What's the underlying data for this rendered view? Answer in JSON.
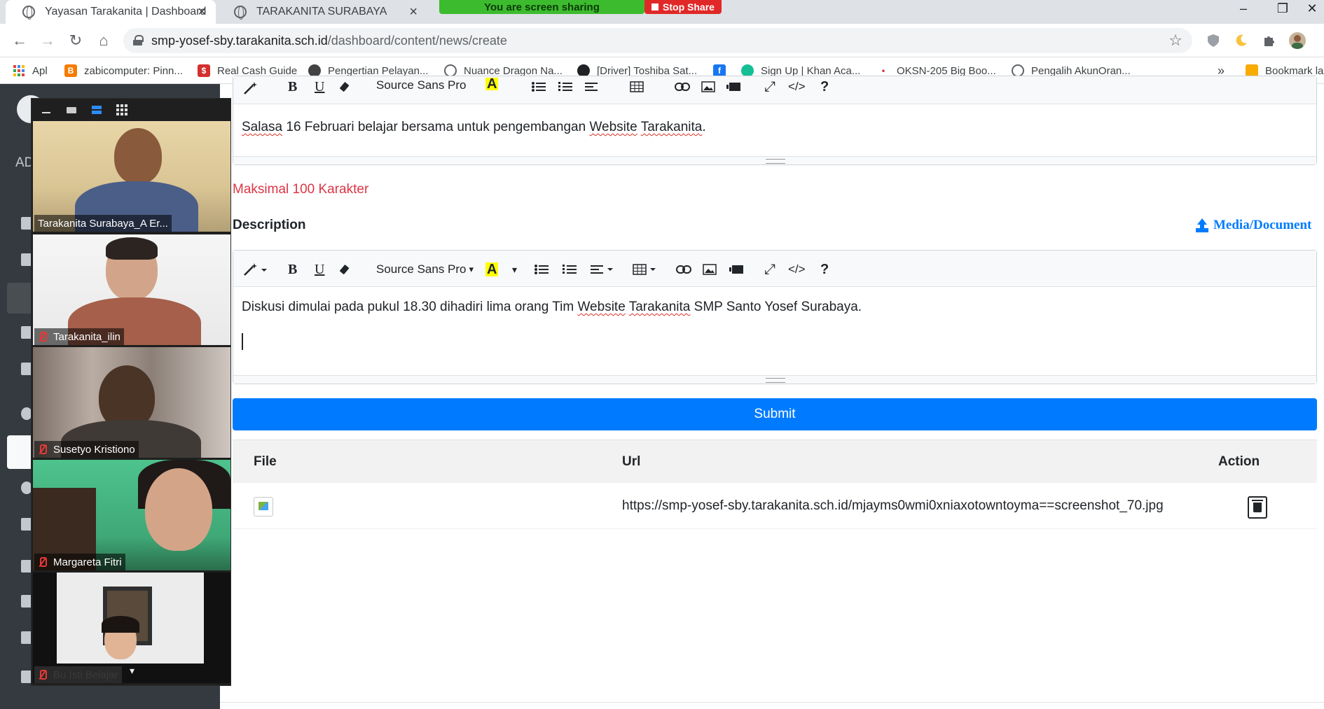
{
  "browser": {
    "tabs": [
      {
        "title": "Yayasan Tarakanita | Dashboard",
        "active": true
      },
      {
        "title": "TARAKANITA SURABAYA",
        "active": false
      }
    ],
    "close_glyph": "×",
    "url_host": "smp-yosef-sby.tarakanita.sch.id",
    "url_path": "/dashboard/content/news/create",
    "window_controls": {
      "minimize": "–",
      "restore": "❐",
      "close": "✕"
    },
    "nav_glyphs": {
      "back": "←",
      "forward": "→",
      "reload": "↻",
      "home": "⌂",
      "star": "☆",
      "more": "»"
    },
    "bookmarks": [
      {
        "label": "Apl",
        "color": "#4285f4"
      },
      {
        "label": "zabicomputer: Pinn...",
        "color": "#f57c00"
      },
      {
        "label": "Real Cash Guide",
        "color": "#d32f2f"
      },
      {
        "label": "Pengertian Pelayan...",
        "color": "#424242"
      },
      {
        "label": "Nuance Dragon Na...",
        "color": "#5f6368"
      },
      {
        "label": "[Driver] Toshiba Sat...",
        "color": "#202124"
      },
      {
        "label": "",
        "color": "#1877f2"
      },
      {
        "label": "Sign Up | Khan Aca...",
        "color": "#14bf96"
      },
      {
        "label": "OKSN-205 Big Boo...",
        "color": "#c62828"
      },
      {
        "label": "Pengalih AkunOran...",
        "color": "#5f6368"
      },
      {
        "label": "Bookmark la",
        "color": "#f9ab00"
      }
    ]
  },
  "share": {
    "banner": "You are screen sharing",
    "stop": "Stop Share"
  },
  "sidebar": {
    "partial_label": "AD"
  },
  "editor1": {
    "font_name": "Source Sans Pro",
    "content_parts": [
      "Salasa",
      " 16 Februari belajar bersama untuk pengembangan ",
      "Website",
      " ",
      "Tarakanita",
      "."
    ]
  },
  "max_char": "Maksimal 100 Karakter",
  "description_label": "Description",
  "media_document": "Media/Document",
  "editor2": {
    "font_name": "Source Sans Pro",
    "content_parts": [
      "Diskusi dimulai pada pukul 18.30 dihadiri lima orang Tim ",
      "Website",
      " ",
      "Tarakanita",
      " SMP Santo Yosef Surabaya."
    ]
  },
  "toolbar_glyphs": {
    "bold": "B",
    "underline": "U",
    "help": "?",
    "code": "</>",
    "highlight": "A",
    "fullscreen": "⤢",
    "caret": "▾"
  },
  "submit_label": "Submit",
  "table": {
    "headers": [
      "File",
      "Url",
      "Action"
    ],
    "rows": [
      {
        "url": "https://smp-yosef-sby.tarakanita.sch.id/mjayms0wmi0xniaxotowntoyma==screenshot_70.jpg"
      }
    ]
  },
  "participants": [
    {
      "name": "Tarakanita Surabaya_A Er...",
      "muted": false
    },
    {
      "name": "Tarakanita_ilin",
      "muted": true
    },
    {
      "name": "Susetyo Kristiono",
      "muted": true
    },
    {
      "name": "Margareta Fitri",
      "muted": true
    },
    {
      "name": "Bu Isti Belajar",
      "muted": true
    }
  ],
  "colors": {
    "primary": "#007bff",
    "danger": "#dc3545",
    "sidebar": "#343a40",
    "share_green": "#3dbb2e",
    "stop_red": "#e02828"
  }
}
